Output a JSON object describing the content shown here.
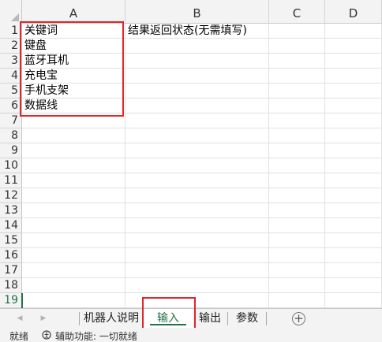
{
  "columns": [
    "A",
    "B",
    "C",
    "D"
  ],
  "rows": [
    {
      "num": "1",
      "a": "关键词",
      "b": "结果返回状态(无需填写)"
    },
    {
      "num": "2",
      "a": "键盘",
      "b": ""
    },
    {
      "num": "3",
      "a": "蓝牙耳机",
      "b": ""
    },
    {
      "num": "4",
      "a": "充电宝",
      "b": ""
    },
    {
      "num": "5",
      "a": "手机支架",
      "b": ""
    },
    {
      "num": "6",
      "a": "数据线",
      "b": ""
    },
    {
      "num": "7",
      "a": "",
      "b": ""
    },
    {
      "num": "8",
      "a": "",
      "b": ""
    },
    {
      "num": "9",
      "a": "",
      "b": ""
    },
    {
      "num": "10",
      "a": "",
      "b": ""
    },
    {
      "num": "11",
      "a": "",
      "b": ""
    },
    {
      "num": "12",
      "a": "",
      "b": ""
    },
    {
      "num": "13",
      "a": "",
      "b": ""
    },
    {
      "num": "14",
      "a": "",
      "b": ""
    },
    {
      "num": "15",
      "a": "",
      "b": ""
    },
    {
      "num": "16",
      "a": "",
      "b": ""
    },
    {
      "num": "17",
      "a": "",
      "b": ""
    },
    {
      "num": "18",
      "a": "",
      "b": ""
    },
    {
      "num": "19",
      "a": "",
      "b": ""
    }
  ],
  "active_row": "19",
  "sheet_tabs": [
    {
      "label": "机器人说明",
      "active": false
    },
    {
      "label": "输入",
      "active": true
    },
    {
      "label": "输出",
      "active": false
    },
    {
      "label": "参数",
      "active": false
    }
  ],
  "add_sheet_icon": "plus-circle-icon",
  "status": {
    "ready": "就绪",
    "accessibility": "辅助功能: 一切就绪"
  },
  "colors": {
    "accent": "#217346",
    "highlight": "#e0262a",
    "header_bg": "#f3f3f3"
  }
}
